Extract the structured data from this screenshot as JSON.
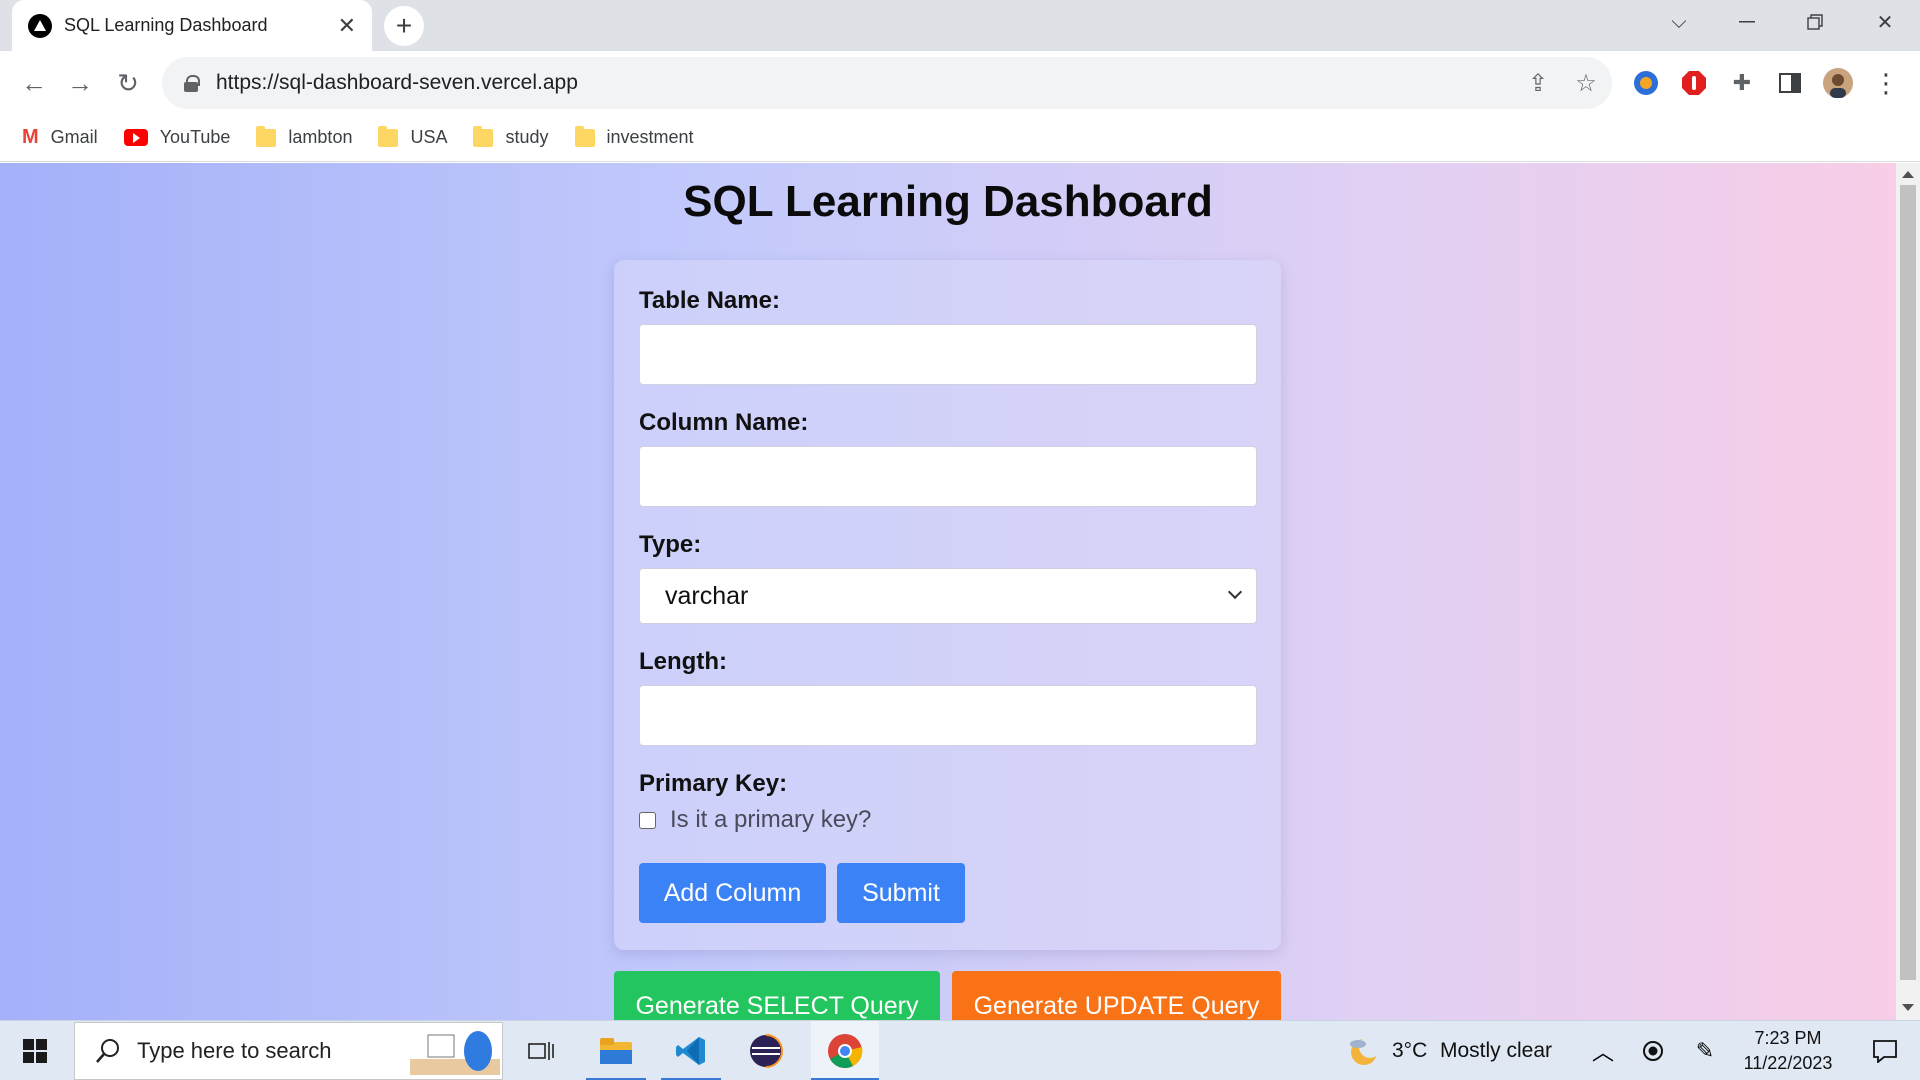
{
  "browser": {
    "tab_title": "SQL Learning Dashboard",
    "url": "https://sql-dashboard-seven.vercel.app",
    "bookmarks": [
      {
        "label": "Gmail",
        "icon": "gmail-icon"
      },
      {
        "label": "YouTube",
        "icon": "youtube-icon"
      },
      {
        "label": "lambton",
        "icon": "folder-icon"
      },
      {
        "label": "USA",
        "icon": "folder-icon"
      },
      {
        "label": "study",
        "icon": "folder-icon"
      },
      {
        "label": "investment",
        "icon": "folder-icon"
      }
    ]
  },
  "page": {
    "title": "SQL Learning Dashboard",
    "form": {
      "table_name_label": "Table Name:",
      "table_name_value": "",
      "column_name_label": "Column Name:",
      "column_name_value": "",
      "type_label": "Type:",
      "type_selected": "varchar",
      "length_label": "Length:",
      "length_value": "",
      "primary_key_label": "Primary Key:",
      "primary_key_checkbox_label": "Is it a primary key?",
      "primary_key_checked": false,
      "add_column_button": "Add Column",
      "submit_button": "Submit"
    },
    "actions": {
      "select_query_button": "Generate SELECT Query",
      "update_query_button": "Generate UPDATE Query"
    },
    "colors": {
      "blue_button": "#3b82f6",
      "green_button": "#22c55e",
      "orange_button": "#f97316"
    }
  },
  "taskbar": {
    "search_placeholder": "Type here to search",
    "weather_temp": "3°C",
    "weather_desc": "Mostly clear",
    "time": "7:23 PM",
    "date": "11/22/2023"
  }
}
